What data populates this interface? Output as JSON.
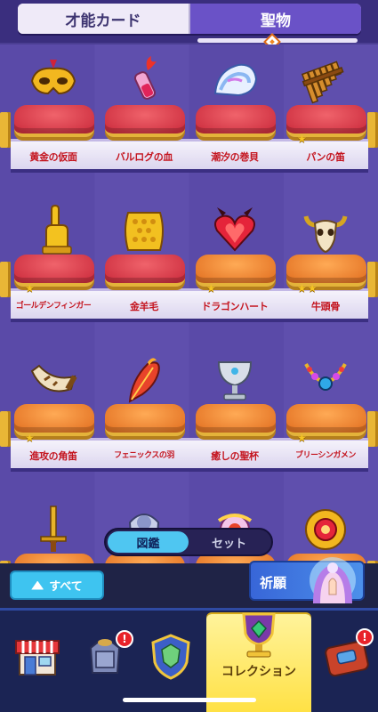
{
  "tabs": {
    "left": "才能カード",
    "right": "聖物"
  },
  "items": [
    {
      "label": "黄金の仮面",
      "cushion": "red",
      "stars": 0,
      "icon": "golden-mask-icon"
    },
    {
      "label": "バルログの血",
      "cushion": "red",
      "stars": 0,
      "icon": "balrog-blood-vial-icon"
    },
    {
      "label": "潮汐の巻貝",
      "cushion": "red",
      "stars": 0,
      "icon": "tidal-conch-icon"
    },
    {
      "label": "パンの笛",
      "cushion": "red",
      "stars": 1,
      "icon": "pan-flute-icon"
    },
    {
      "label": "ゴールデンフィンガー",
      "cushion": "red",
      "stars": 1,
      "icon": "golden-finger-icon"
    },
    {
      "label": "金羊毛",
      "cushion": "red",
      "stars": 0,
      "icon": "golden-fleece-icon"
    },
    {
      "label": "ドラゴンハート",
      "cushion": "orange",
      "stars": 1,
      "icon": "dragon-heart-icon"
    },
    {
      "label": "牛頭骨",
      "cushion": "orange",
      "stars": 2,
      "icon": "bull-skull-icon"
    },
    {
      "label": "進攻の角笛",
      "cushion": "orange",
      "stars": 1,
      "icon": "war-horn-icon"
    },
    {
      "label": "フェニックスの羽",
      "cushion": "orange",
      "stars": 0,
      "icon": "phoenix-feather-icon"
    },
    {
      "label": "癒しの聖杯",
      "cushion": "orange",
      "stars": 0,
      "icon": "healing-chalice-icon"
    },
    {
      "label": "ブリーシンガメン",
      "cushion": "orange",
      "stars": 1,
      "icon": "brisingamen-necklace-icon"
    },
    {
      "label": "",
      "cushion": "orange",
      "stars": 0,
      "icon": "golden-sword-icon"
    },
    {
      "label": "",
      "cushion": "orange",
      "stars": 0,
      "icon": "armor-figure-icon"
    },
    {
      "label": "",
      "cushion": "orange",
      "stars": 0,
      "icon": "orb-ring-icon"
    },
    {
      "label": "",
      "cushion": "orange",
      "stars": 0,
      "icon": "sun-medallion-icon"
    }
  ],
  "toggle": {
    "active": "図鑑",
    "inactive": "セット"
  },
  "filter": {
    "all_label": "すべて",
    "pray_label": "祈願"
  },
  "nav": {
    "active_label": "コレクション",
    "badge_text": "!"
  },
  "colors": {
    "background": "#5a4aa8",
    "tab_active": "#6a52c7",
    "label_red": "#c4141e",
    "toggle_active": "#4fc6f1",
    "nav_active": "#ffe145"
  }
}
